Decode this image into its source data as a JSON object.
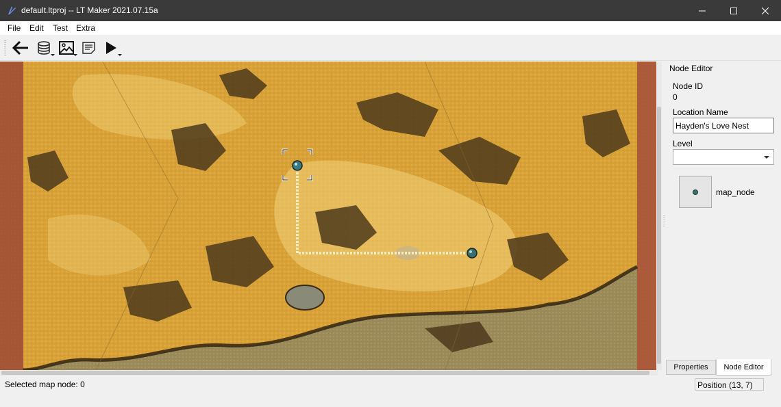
{
  "window": {
    "title": "default.ltproj -- LT Maker 2021.07.15a",
    "controls": [
      "minimize-icon",
      "maximize-icon",
      "close-icon"
    ]
  },
  "menu": [
    "File",
    "Edit",
    "Test",
    "Extra"
  ],
  "toolbar": {
    "buttons": [
      "back-arrow-icon",
      "database-icon",
      "image-icon",
      "notes-icon",
      "play-icon"
    ]
  },
  "map": {
    "nodes": [
      "selected-node",
      "map-node"
    ],
    "selected_node_id": "0"
  },
  "node_editor": {
    "dock_title": "Node Editor",
    "node_id_label": "Node ID",
    "node_id_value": "0",
    "location_name_label": "Location Name",
    "location_name_value": "Hayden's Love Nest",
    "level_label": "Level",
    "level_value": "",
    "icon_label": "map_node"
  },
  "tabs": [
    "Properties",
    "Node Editor"
  ],
  "status": {
    "message": "Selected map node: 0",
    "position": "Position (13, 7)"
  },
  "colors": {
    "titlebar": "#3a3a3a",
    "map_base": "#d8a238",
    "map_dark": "#4e3a1c",
    "map_light": "#f2d27a",
    "node": "#3d6e6e",
    "road": "#f7ecc0"
  }
}
